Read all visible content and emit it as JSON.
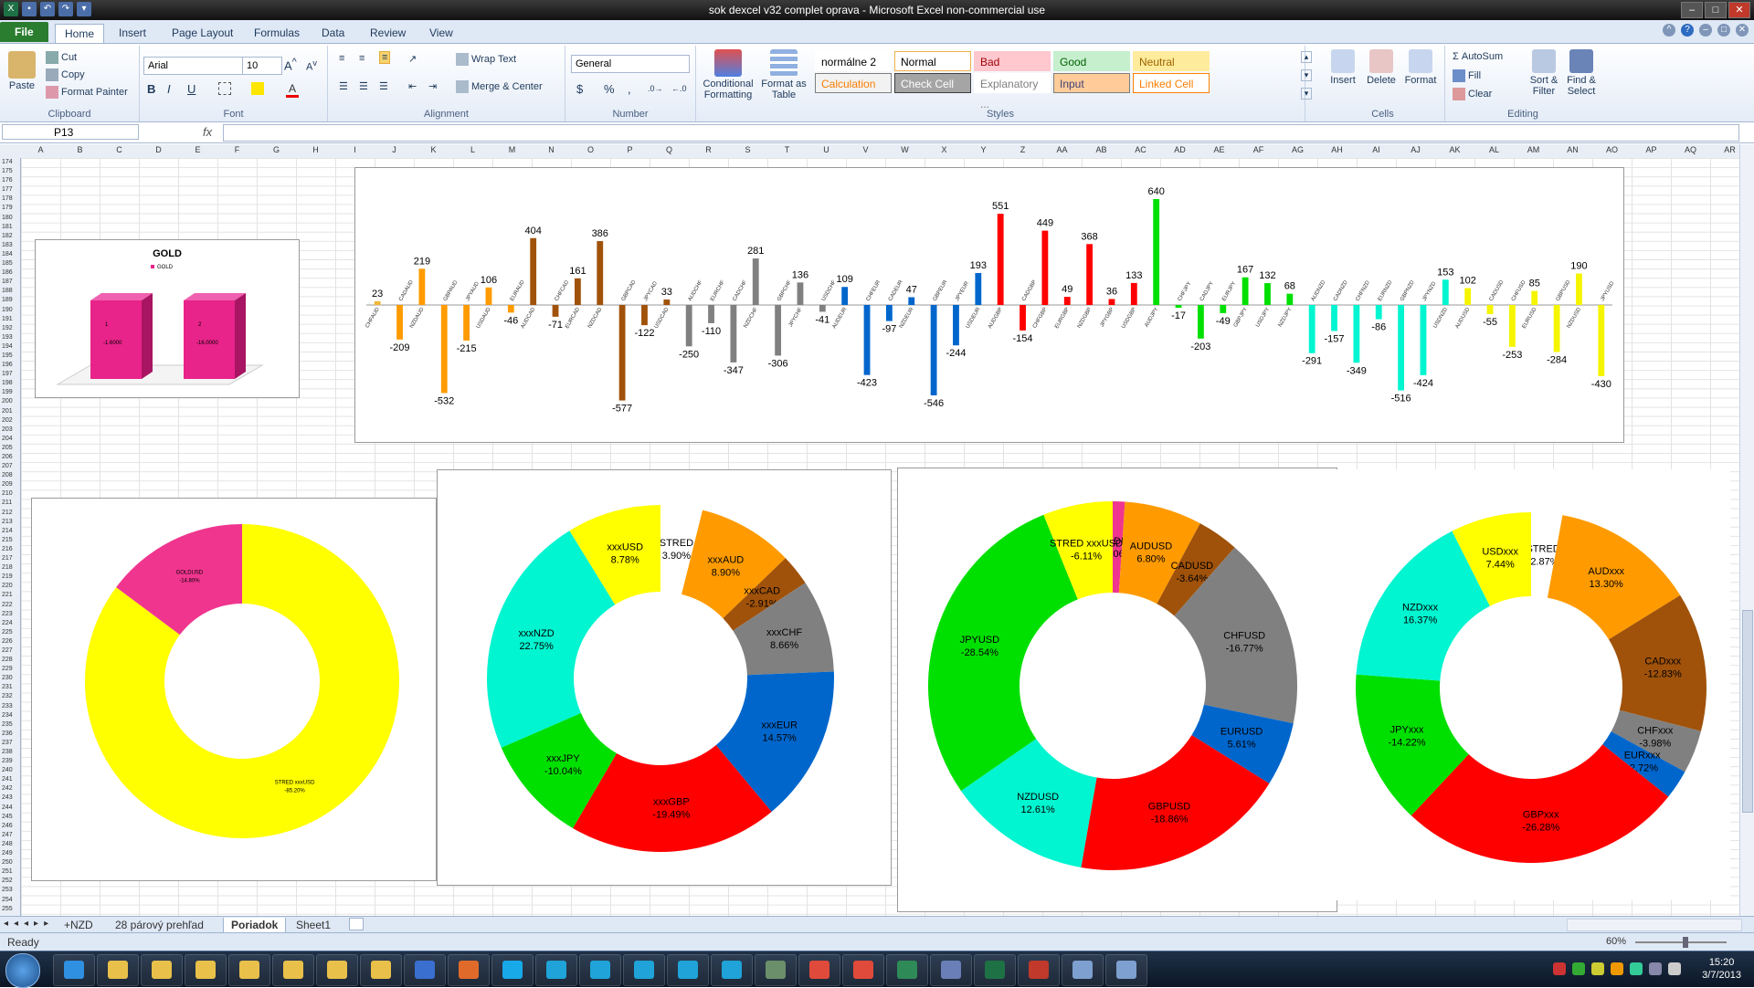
{
  "window": {
    "title": "sok dexcel v32 complet oprava  -  Microsoft Excel non-commercial use"
  },
  "tabs": [
    "File",
    "Home",
    "Insert",
    "Page Layout",
    "Formulas",
    "Data",
    "Review",
    "View"
  ],
  "ribbon": {
    "clipboard": {
      "paste": "Paste",
      "cut": "Cut",
      "copy": "Copy",
      "format_painter": "Format Painter",
      "label": "Clipboard"
    },
    "font": {
      "name": "Arial",
      "size": "10",
      "label": "Font",
      "bold": "B",
      "italic": "I",
      "underline": "U"
    },
    "alignment": {
      "wrap": "Wrap Text",
      "merge": "Merge & Center",
      "label": "Alignment"
    },
    "number": {
      "format": "General",
      "label": "Number",
      "currency": "$",
      "percent": "%",
      "comma": ","
    },
    "styles": {
      "conditional": "Conditional Formatting",
      "format_table": "Format as Table",
      "label": "Styles",
      "cells": [
        {
          "name": "normálne 2",
          "bg": "#ffffff",
          "color": "#000000",
          "border": "#ffffff"
        },
        {
          "name": "Normal",
          "bg": "#ffffff",
          "color": "#000000",
          "border": "#f0b14a"
        },
        {
          "name": "Bad",
          "bg": "#ffc7ce",
          "color": "#9c0006",
          "border": "#ffc7ce"
        },
        {
          "name": "Good",
          "bg": "#c6efce",
          "color": "#006100",
          "border": "#c6efce"
        },
        {
          "name": "Neutral",
          "bg": "#ffeb9c",
          "color": "#9c6500",
          "border": "#ffeb9c"
        },
        {
          "name": "Calculation",
          "bg": "#f2f2f2",
          "color": "#fa7d00",
          "border": "#7f7f7f"
        },
        {
          "name": "Check Cell",
          "bg": "#a5a5a5",
          "color": "#ffffff",
          "border": "#3f3f3f"
        },
        {
          "name": "Explanatory ...",
          "bg": "#ffffff",
          "color": "#7f7f7f",
          "border": "#ffffff"
        },
        {
          "name": "Input",
          "bg": "#ffcc99",
          "color": "#3f3f76",
          "border": "#7f7f7f"
        },
        {
          "name": "Linked Cell",
          "bg": "#ffffff",
          "color": "#fa7d00",
          "border": "#ff8001"
        }
      ]
    },
    "cells": {
      "insert": "Insert",
      "delete": "Delete",
      "format": "Format",
      "label": "Cells"
    },
    "editing": {
      "autosum": "AutoSum",
      "fill": "Fill",
      "clear": "Clear",
      "sort": "Sort & Filter",
      "find": "Find & Select",
      "label": "Editing"
    }
  },
  "formula_bar": {
    "name_box": "P13",
    "fx": "fx",
    "value": ""
  },
  "columns": [
    "A",
    "B",
    "C",
    "D",
    "E",
    "F",
    "G",
    "H",
    "I",
    "J",
    "K",
    "L",
    "M",
    "N",
    "O",
    "P",
    "Q",
    "R",
    "S",
    "T",
    "U",
    "V",
    "W",
    "X",
    "Y",
    "Z",
    "AA",
    "AB",
    "AC",
    "AD",
    "AE",
    "AF",
    "AG",
    "AH",
    "AI",
    "AJ",
    "AK",
    "AL",
    "AM",
    "AN",
    "AO",
    "AP",
    "AQ",
    "AR",
    "AS",
    "AT"
  ],
  "rows": {
    "start": 174,
    "end": 255
  },
  "sheet_tabs": [
    "+NZD",
    "28 párový prehľad",
    "Poriadok",
    "Sheet1"
  ],
  "active_sheet": "Poriadok",
  "status": {
    "ready": "Ready",
    "zoom": "60%"
  },
  "clock": {
    "time": "15:20",
    "date": "3/7/2013"
  },
  "taskbar_icons": [
    "ie",
    "folder",
    "folder",
    "folder",
    "folder",
    "folder",
    "folder",
    "folder",
    "display",
    "media",
    "skype",
    "chat",
    "chat",
    "chat",
    "chat",
    "chat",
    "tool",
    "chrome",
    "chrome",
    "excel-green",
    "chart",
    "excel",
    "tool-red",
    "app",
    "app"
  ],
  "chart_data": [
    {
      "type": "bar",
      "title": "",
      "categories": [
        "CHFAUD",
        "CADAUD",
        "NZDAUD",
        "GBPAUD",
        "JPYAUD",
        "USDAUD",
        "EURAUD",
        "AUDCAD",
        "CHFCAD",
        "EURCAD",
        "NZDCAD",
        "GBPCAD",
        "JPYCAD",
        "USDCAD",
        "AUDCHF",
        "EURCHF",
        "CADCHF",
        "NZDCHF",
        "GBPCHF",
        "JPYCHF",
        "USDCHF",
        "AUDEUR",
        "CHFEUR",
        "CADEUR",
        "NZDEUR",
        "GBPEUR",
        "JPYEUR",
        "USDEUR",
        "AUDGBP",
        "CADGBP",
        "CHFGBP",
        "EURGBP",
        "NZDGBP",
        "JPYGBP",
        "USDGBP",
        "AUDJPY",
        "CHFJPY",
        "CADJPY",
        "EURJPY",
        "GBPJPY",
        "USDJPY",
        "NZDJPY",
        "AUDNZD",
        "CADNZD",
        "CHFNZD",
        "EURNZD",
        "GBPNZD",
        "JPYNZD",
        "USDNZD",
        "AUDUSD",
        "CADUSD",
        "CHFUSD",
        "EURUSD",
        "GBPUSD",
        "NZDUSD",
        "JPYUSD"
      ],
      "values": [
        23,
        -209,
        219,
        -532,
        -215,
        106,
        -46,
        404,
        -71,
        161,
        386,
        -577,
        -122,
        33,
        -250,
        -110,
        -347,
        281,
        -306,
        136,
        -41,
        109,
        -423,
        -97,
        47,
        -546,
        -244,
        193,
        551,
        -154,
        449,
        49,
        368,
        36,
        133,
        640,
        -17,
        -203,
        -49,
        167,
        132,
        68,
        -291,
        -157,
        -349,
        -86,
        -516,
        -424,
        153,
        102,
        -55,
        -253,
        85,
        -284,
        190,
        -430
      ],
      "colors": [
        "#f0b73a",
        "#ff9b00",
        "#ff9b00",
        "#ff9b00",
        "#ff9b00",
        "#ff9b00",
        "#ff9b00",
        "#a0520a",
        "#a0520a",
        "#a0520a",
        "#a0520a",
        "#a0520a",
        "#a0520a",
        "#a0520a",
        "#808080",
        "#808080",
        "#808080",
        "#808080",
        "#808080",
        "#808080",
        "#808080",
        "#0066cc",
        "#0066cc",
        "#0066cc",
        "#0066cc",
        "#0066cc",
        "#0066cc",
        "#0066cc",
        "#ff0000",
        "#ff0000",
        "#ff0000",
        "#ff0000",
        "#ff0000",
        "#ff0000",
        "#ff0000",
        "#00e000",
        "#00e000",
        "#00e000",
        "#00e000",
        "#00e000",
        "#00e000",
        "#00e000",
        "#00f5d0",
        "#00f5d0",
        "#00f5d0",
        "#00f5d0",
        "#00f5d0",
        "#00f5d0",
        "#00f5d0",
        "#f5f500",
        "#f5f500",
        "#f5f500",
        "#f5f500",
        "#f5f500",
        "#f5f500",
        "#f5f500"
      ],
      "ylim": [
        -640,
        640
      ]
    },
    {
      "type": "bar",
      "title": "GOLD",
      "legend": [
        "GOLD"
      ],
      "categories": [
        "1",
        "2"
      ],
      "values": [
        -1.6,
        -16.0
      ],
      "data_labels": [
        "-1.6000",
        "-16.0000"
      ],
      "color": "#e8238a"
    },
    {
      "type": "pie",
      "labels": [
        "STRED xxxUSD",
        "GOLDUSD"
      ],
      "values": [
        85.2,
        14.8
      ],
      "data_labels": [
        "STRED xxxUSD\n-85.20%",
        "GOLDUSD\n-14.80%"
      ],
      "colors": [
        "#ffff00",
        "#f0358f"
      ]
    },
    {
      "type": "pie",
      "labels": [
        "STRED",
        "xxxAUD",
        "xxxCAD",
        "xxxCHF",
        "xxxEUR",
        "xxxGBP",
        "xxxJPY",
        "xxxNZD",
        "xxxUSD"
      ],
      "values": [
        3.9,
        8.9,
        2.91,
        8.66,
        14.57,
        19.49,
        10.04,
        22.75,
        8.78
      ],
      "data_labels": [
        "STRED\n3.90%",
        "xxxAUD\n8.90%",
        "xxxCAD\n-2.91%",
        "xxxCHF\n8.66%",
        "xxxEUR\n14.57%",
        "xxxGBP\n-19.49%",
        "xxxJPY\n-10.04%",
        "xxxNZD\n22.75%",
        "xxxUSD\n8.78%"
      ],
      "colors": [
        "#ffffff",
        "#ff9b00",
        "#a0520a",
        "#808080",
        "#0066cc",
        "#ff0000",
        "#00e000",
        "#00f5d0",
        "#ffff00"
      ]
    },
    {
      "type": "pie",
      "labels": [
        "GOLDUSD",
        "AUDUSD",
        "CADUSD",
        "CHFUSD",
        "EURUSD",
        "GBPUSD",
        "NZDUSD",
        "JPYUSD",
        "STRED xxxUSD"
      ],
      "values": [
        1.06,
        6.8,
        3.64,
        16.77,
        5.61,
        18.86,
        12.61,
        28.54,
        6.11
      ],
      "data_labels": [
        "GOLDUSD\n-1.06%",
        "AUDUSD\n6.80%",
        "CADUSD\n-3.64%",
        "CHFUSD\n-16.77%",
        "EURUSD\n5.61%",
        "GBPUSD\n-18.86%",
        "NZDUSD\n12.61%",
        "JPYUSD\n-28.54%",
        "STRED xxxUSD\n-6.11%"
      ],
      "colors": [
        "#f0358f",
        "#ff9b00",
        "#a0520a",
        "#808080",
        "#0066cc",
        "#ff0000",
        "#00f5d0",
        "#00e000",
        "#ffff00"
      ]
    },
    {
      "type": "pie",
      "labels": [
        "STRED",
        "AUDxxx",
        "CADxxx",
        "CHFxxx",
        "EURxxx",
        "GBPxxx",
        "JPYxxx",
        "NZDxxx",
        "USDxxx"
      ],
      "values": [
        2.87,
        13.3,
        12.83,
        3.98,
        2.72,
        26.28,
        14.22,
        16.37,
        7.44
      ],
      "data_labels": [
        "STRED\n-2.87%",
        "AUDxxx\n13.30%",
        "CADxxx\n-12.83%",
        "CHFxxx\n-3.98%",
        "EURxxx\n-2.72%",
        "GBPxxx\n-26.28%",
        "JPYxxx\n-14.22%",
        "NZDxxx\n16.37%",
        "USDxxx\n7.44%"
      ],
      "colors": [
        "#ffffff",
        "#ff9b00",
        "#a0520a",
        "#808080",
        "#0066cc",
        "#ff0000",
        "#00e000",
        "#00f5d0",
        "#ffff00"
      ]
    }
  ]
}
